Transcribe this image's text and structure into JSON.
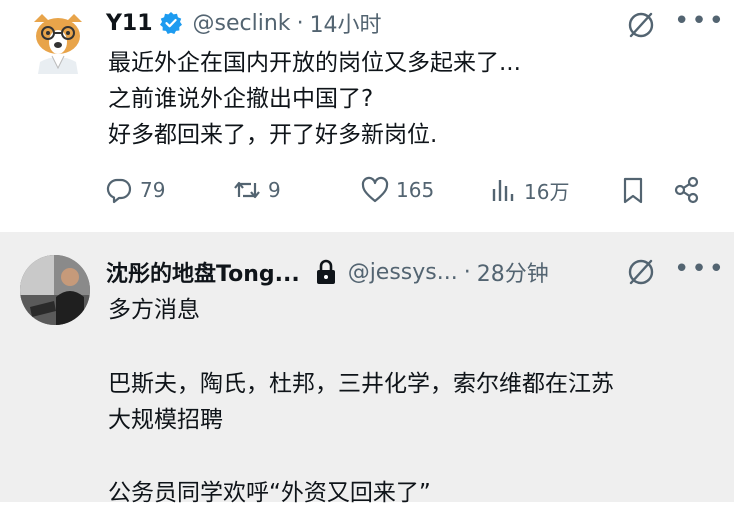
{
  "tweet1": {
    "display_name": "Y11",
    "handle": "@seclink",
    "separator": "·",
    "time": "14小时",
    "lines": [
      "最近外企在国内开放的岗位又多起来了...",
      "之前谁说外企撤出中国了?",
      "好多都回来了，开了好多新岗位."
    ],
    "stats": {
      "replies": "79",
      "retweets": "9",
      "likes": "165",
      "views": "16万"
    }
  },
  "tweet2": {
    "display_name": "沈彤的地盘Tong...",
    "handle": "@jessys...",
    "separator": "·",
    "time": "28分钟",
    "lines": [
      "多方消息",
      "巴斯夫，陶氏，杜邦，三井化学，索尔维都在江苏",
      "大规模招聘",
      "公务员同学欢呼“外资又回来了”"
    ]
  },
  "icons": {
    "verified": "verified-badge-icon",
    "grok": "grok-icon",
    "more": "more-icon",
    "reply": "reply-icon",
    "retweet": "retweet-icon",
    "like": "like-icon",
    "views": "views-icon",
    "bookmark": "bookmark-icon",
    "share": "share-icon",
    "lock": "lock-icon"
  },
  "colors": {
    "verified": "#1d9bf0",
    "secondary_text": "#536471",
    "primary_text": "#0f1419",
    "reply_background": "#efefef"
  }
}
